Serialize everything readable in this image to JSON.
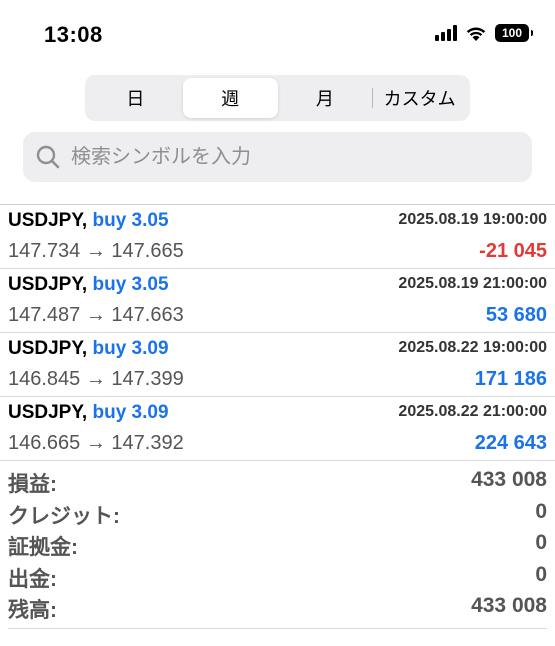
{
  "status": {
    "time": "13:08",
    "battery": "100",
    "icons": [
      "signal-icon",
      "wifi-icon",
      "battery-icon"
    ]
  },
  "segments": [
    {
      "label": "日",
      "active": false
    },
    {
      "label": "週",
      "active": true
    },
    {
      "label": "月",
      "active": false
    },
    {
      "label": "カスタム",
      "active": false
    }
  ],
  "search": {
    "placeholder": "検索シンボルを入力"
  },
  "trades": [
    {
      "symbol": "USDJPY,",
      "side": "buy 3.05",
      "datetime": "2025.08.19 19:00:00",
      "prices": "147.734 → 147.665",
      "profit": "-21 045",
      "sign": "neg"
    },
    {
      "symbol": "USDJPY,",
      "side": "buy 3.05",
      "datetime": "2025.08.19 21:00:00",
      "prices": "147.487 → 147.663",
      "profit": "53 680",
      "sign": "pos"
    },
    {
      "symbol": "USDJPY,",
      "side": "buy 3.09",
      "datetime": "2025.08.22 19:00:00",
      "prices": "146.845 → 147.399",
      "profit": "171 186",
      "sign": "pos"
    },
    {
      "symbol": "USDJPY,",
      "side": "buy 3.09",
      "datetime": "2025.08.22 21:00:00",
      "prices": "146.665 → 147.392",
      "profit": "224 643",
      "sign": "pos"
    }
  ],
  "summary": [
    {
      "label": "損益:",
      "value": "433 008"
    },
    {
      "label": "クレジット:",
      "value": "0"
    },
    {
      "label": "証拠金:",
      "value": "0"
    },
    {
      "label": "出金:",
      "value": "0"
    },
    {
      "label": "残高:",
      "value": "433 008"
    }
  ],
  "colors": {
    "accent": "#1a73e8",
    "negative": "#e53935"
  }
}
